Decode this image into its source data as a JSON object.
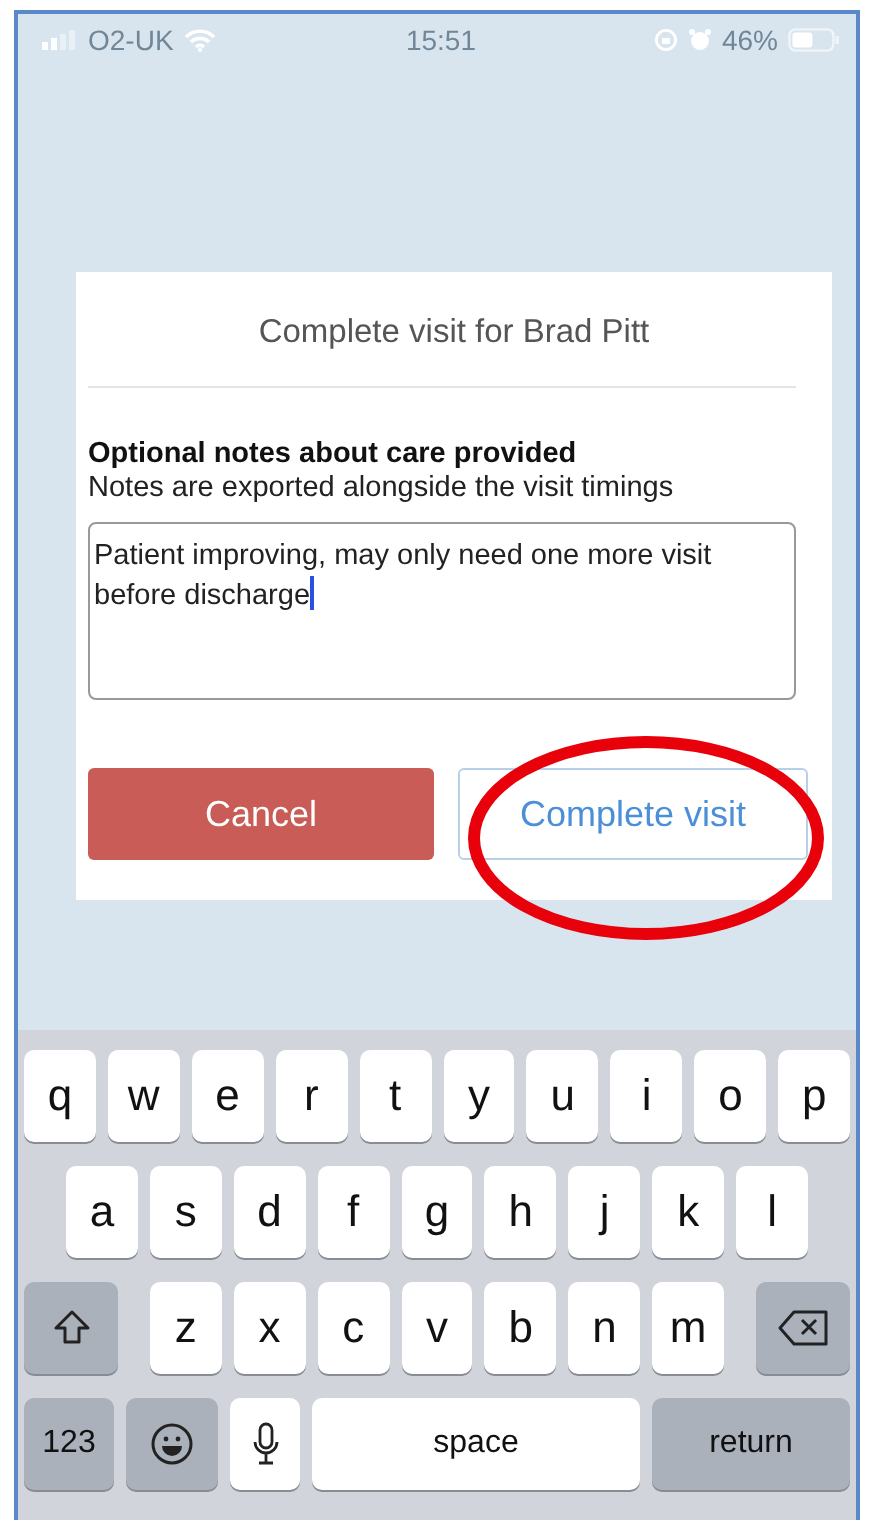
{
  "status_bar": {
    "carrier": "O2-UK",
    "time": "15:51",
    "battery": "46%"
  },
  "dialog": {
    "title": "Complete visit for Brad Pitt",
    "notes_label": "Optional notes about care provided",
    "notes_hint": "Notes are exported alongside the visit timings",
    "notes": {
      "value": "Patient improving, may only need one more visit before discharge",
      "focused": true
    },
    "buttons": [
      {
        "label": "Cancel",
        "kind": "danger"
      },
      {
        "label": "Complete visit",
        "kind": "secondary"
      }
    ]
  },
  "keyboard": {
    "rows": [
      {
        "keys": [
          {
            "kind": "letter",
            "label": "q"
          },
          {
            "kind": "letter",
            "label": "w"
          },
          {
            "kind": "letter",
            "label": "e"
          },
          {
            "kind": "letter",
            "label": "r"
          },
          {
            "kind": "letter",
            "label": "t"
          },
          {
            "kind": "letter",
            "label": "y"
          },
          {
            "kind": "letter",
            "label": "u"
          },
          {
            "kind": "letter",
            "label": "i"
          },
          {
            "kind": "letter",
            "label": "o"
          },
          {
            "kind": "letter",
            "label": "p"
          }
        ]
      },
      {
        "keys": [
          {
            "kind": "letter",
            "label": "a"
          },
          {
            "kind": "letter",
            "label": "s"
          },
          {
            "kind": "letter",
            "label": "d"
          },
          {
            "kind": "letter",
            "label": "f"
          },
          {
            "kind": "letter",
            "label": "g"
          },
          {
            "kind": "letter",
            "label": "h"
          },
          {
            "kind": "letter",
            "label": "j"
          },
          {
            "kind": "letter",
            "label": "k"
          },
          {
            "kind": "letter",
            "label": "l"
          }
        ]
      },
      {
        "keys": [
          {
            "kind": "shift"
          },
          {
            "kind": "letter",
            "label": "z"
          },
          {
            "kind": "letter",
            "label": "x"
          },
          {
            "kind": "letter",
            "label": "c"
          },
          {
            "kind": "letter",
            "label": "v"
          },
          {
            "kind": "letter",
            "label": "b"
          },
          {
            "kind": "letter",
            "label": "n"
          },
          {
            "kind": "letter",
            "label": "m"
          },
          {
            "kind": "delete"
          }
        ]
      },
      {
        "keys": [
          {
            "kind": "numbers",
            "label": "123"
          },
          {
            "kind": "emoji"
          },
          {
            "kind": "mic"
          },
          {
            "kind": "space",
            "label": "space"
          },
          {
            "kind": "return",
            "label": "return"
          }
        ]
      }
    ]
  }
}
